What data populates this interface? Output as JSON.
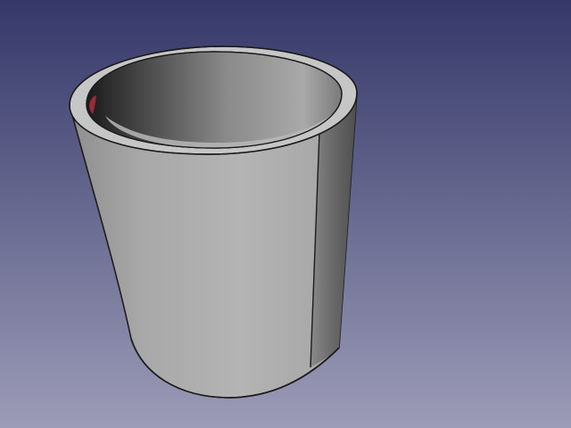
{
  "viewport": {
    "background_top_color": "#353869",
    "background_bottom_color": "#9c9cb8"
  },
  "model": {
    "object": "hollow-cylinder",
    "outer_surface_color": "#b5b5b5",
    "inner_surface_color": "#6a6a6a",
    "rim_face_color": "#c9c9c9",
    "edge_color": "#1c1c1c",
    "interior_highlight_color": "#9b2a3a"
  }
}
